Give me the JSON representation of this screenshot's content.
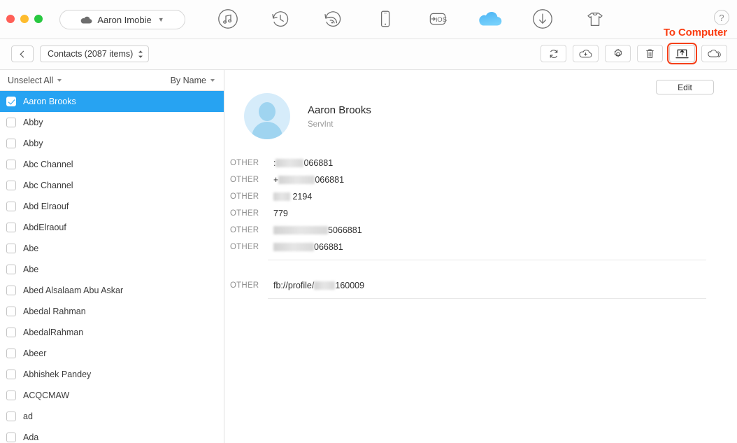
{
  "window": {
    "traffic_lights": [
      "close",
      "minimize",
      "maximize"
    ],
    "account_label": "Aaron  Imobie",
    "help_label": "?"
  },
  "nav_tabs": [
    {
      "name": "music",
      "icon": "music-note-circle-icon",
      "active": false
    },
    {
      "name": "restore",
      "icon": "history-clock-icon",
      "active": false
    },
    {
      "name": "airdrop",
      "icon": "wifi-transfer-icon",
      "active": false
    },
    {
      "name": "device",
      "icon": "phone-icon",
      "active": false
    },
    {
      "name": "to-ios",
      "icon": "to-ios-icon",
      "active": false
    },
    {
      "name": "icloud",
      "icon": "cloud-icon",
      "active": true
    },
    {
      "name": "download",
      "icon": "download-circle-icon",
      "active": false
    },
    {
      "name": "toolkit",
      "icon": "toolkit-shirt-icon",
      "active": false
    }
  ],
  "annotation": {
    "text": "To Computer",
    "color": "#fa3c10"
  },
  "subtoolbar": {
    "back_label": "‹",
    "source_label": "Contacts (2087 items)",
    "tools": [
      {
        "name": "refresh-button",
        "icon": "refresh-icon",
        "highlighted": false
      },
      {
        "name": "add-to-cloud-button",
        "icon": "cloud-plus-icon",
        "highlighted": false
      },
      {
        "name": "settings-button",
        "icon": "gear-icon",
        "highlighted": false
      },
      {
        "name": "delete-button",
        "icon": "trash-icon",
        "highlighted": false
      },
      {
        "name": "to-computer-button",
        "icon": "export-to-computer-icon",
        "highlighted": true
      },
      {
        "name": "to-icloud-button",
        "icon": "cloud-sync-icon",
        "highlighted": false
      }
    ]
  },
  "list": {
    "select_all_label": "Unselect All",
    "sort_label": "By Name",
    "selection_color": "#27a3f2",
    "items": [
      {
        "name": "Aaron Brooks",
        "checked": true,
        "selected": true
      },
      {
        "name": "Abby",
        "checked": false,
        "selected": false
      },
      {
        "name": "Abby",
        "checked": false,
        "selected": false
      },
      {
        "name": "Abc Channel",
        "checked": false,
        "selected": false
      },
      {
        "name": "Abc Channel",
        "checked": false,
        "selected": false
      },
      {
        "name": "Abd Elraouf",
        "checked": false,
        "selected": false
      },
      {
        "name": "AbdElraouf",
        "checked": false,
        "selected": false
      },
      {
        "name": "Abe",
        "checked": false,
        "selected": false
      },
      {
        "name": "Abe",
        "checked": false,
        "selected": false
      },
      {
        "name": "Abed Alsalaam Abu Askar",
        "checked": false,
        "selected": false
      },
      {
        "name": "Abedal Rahman",
        "checked": false,
        "selected": false
      },
      {
        "name": "AbedalRahman",
        "checked": false,
        "selected": false
      },
      {
        "name": "Abeer",
        "checked": false,
        "selected": false
      },
      {
        "name": "Abhishek Pandey",
        "checked": false,
        "selected": false
      },
      {
        "name": "ACQCMAW",
        "checked": false,
        "selected": false
      },
      {
        "name": "ad",
        "checked": false,
        "selected": false
      },
      {
        "name": "Ada",
        "checked": false,
        "selected": false
      }
    ]
  },
  "detail": {
    "edit_label": "Edit",
    "name": "Aaron  Brooks",
    "organization": "ServInt",
    "fields": [
      {
        "label": "OTHER",
        "prefix": ":",
        "redact_width": 40,
        "suffix": "066881"
      },
      {
        "label": "OTHER",
        "prefix": "+",
        "redact_width": 52,
        "suffix": "066881"
      },
      {
        "label": "OTHER",
        "prefix": "",
        "redact_width": 24,
        "suffix": " 2194"
      },
      {
        "label": "OTHER",
        "prefix": "779",
        "redact_width": 0,
        "suffix": ""
      },
      {
        "label": "OTHER",
        "prefix": "",
        "redact_width": 78,
        "suffix": "5066881"
      },
      {
        "label": "OTHER",
        "prefix": "",
        "redact_width": 58,
        "suffix": "066881"
      }
    ],
    "fields2": [
      {
        "label": "OTHER",
        "prefix": "fb://profile/",
        "redact_width": 30,
        "suffix": "160009"
      }
    ]
  }
}
